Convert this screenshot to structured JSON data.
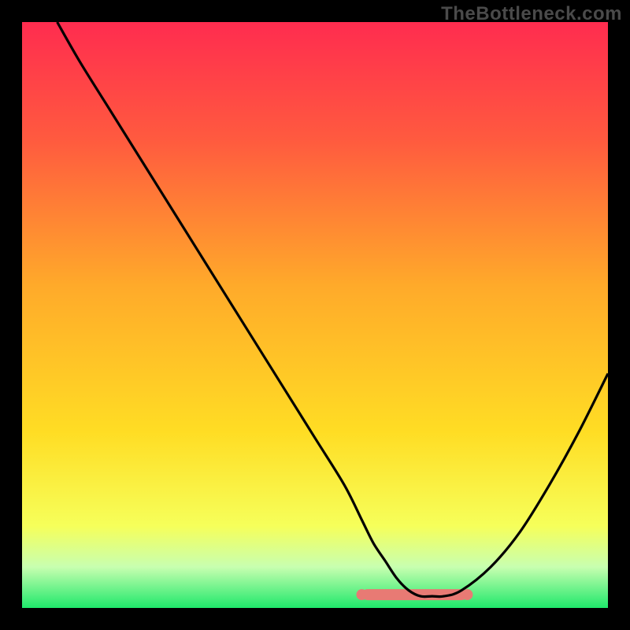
{
  "watermark": "TheBottleneck.com",
  "colors": {
    "frame": "#000000",
    "gradient_top": "#ff2c4f",
    "gradient_mid": "#ffdd24",
    "gradient_bottom": "#1fe86b",
    "curve": "#000000",
    "valley_band": "#e87a74"
  },
  "chart_data": {
    "type": "line",
    "title": "",
    "xlabel": "",
    "ylabel": "",
    "xlim": [
      0,
      100
    ],
    "ylim": [
      0,
      100
    ],
    "x": [
      6,
      10,
      15,
      20,
      25,
      30,
      35,
      40,
      45,
      50,
      55,
      58,
      60,
      62,
      64,
      66,
      68,
      70,
      72,
      75,
      80,
      85,
      90,
      95,
      100
    ],
    "values": [
      100,
      93,
      85,
      77,
      69,
      61,
      53,
      45,
      37,
      29,
      21,
      15,
      11,
      8,
      5,
      3,
      2,
      2,
      2,
      3,
      7,
      13,
      21,
      30,
      40
    ],
    "valley_x_range": [
      58,
      76
    ],
    "notes": "V-shaped bottleneck curve over rainbow gradient; valley floor ~2% around x≈68–72; pink ‘optimal’ marker band across the valley bottom."
  }
}
